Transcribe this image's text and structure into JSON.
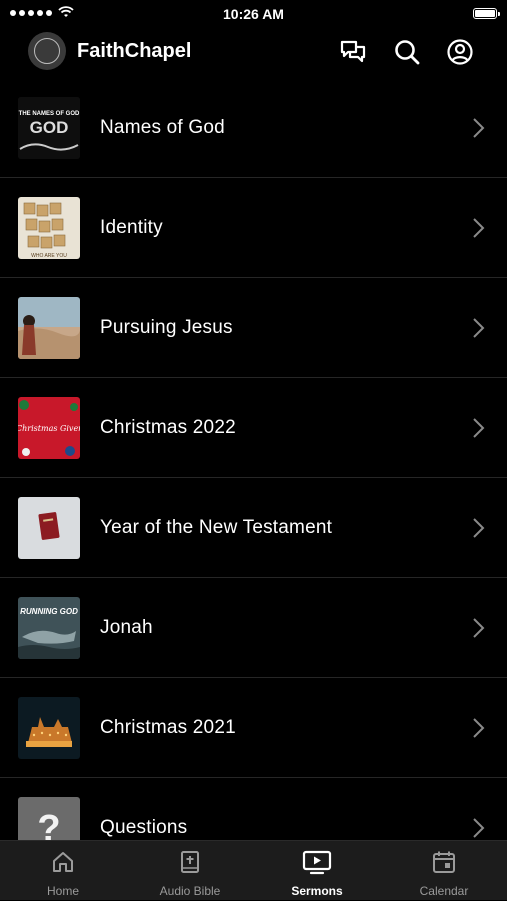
{
  "status_bar": {
    "time": "10:26 AM"
  },
  "header": {
    "title": "FaithChapel",
    "logo_alt": "FAITH CHAPEL"
  },
  "sermons": [
    {
      "title": "Names of God",
      "thumb": "names-of-god",
      "thumb_text": "THE NAMES OF GOD"
    },
    {
      "title": "Identity",
      "thumb": "identity",
      "thumb_text": "WHO ARE YOU"
    },
    {
      "title": "Pursuing Jesus",
      "thumb": "pursuing-jesus"
    },
    {
      "title": "Christmas 2022",
      "thumb": "christmas-2022",
      "thumb_text": "Christmas Giver"
    },
    {
      "title": "Year of the New Testament",
      "thumb": "new-testament"
    },
    {
      "title": "Jonah",
      "thumb": "jonah",
      "thumb_text": "RUNNING GOD"
    },
    {
      "title": "Christmas 2021",
      "thumb": "christmas-2021"
    },
    {
      "title": "Questions",
      "thumb": "questions",
      "thumb_text": "?"
    }
  ],
  "tabs": [
    {
      "label": "Home",
      "icon": "home-icon",
      "active": false
    },
    {
      "label": "Audio Bible",
      "icon": "bible-icon",
      "active": false
    },
    {
      "label": "Sermons",
      "icon": "tv-play-icon",
      "active": true
    },
    {
      "label": "Calendar",
      "icon": "calendar-icon",
      "active": false
    }
  ],
  "colors": {
    "background": "#000000",
    "tab_bar": "#1c1c1c",
    "divider": "#262626",
    "inactive_tab": "#9a9a9a"
  }
}
